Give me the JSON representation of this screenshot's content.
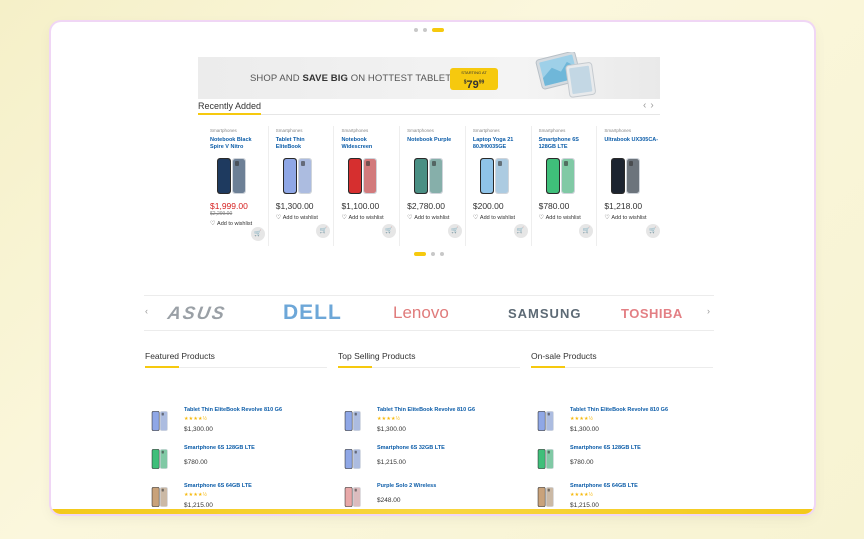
{
  "banner": {
    "text_pre": "SHOP AND ",
    "text_bold": "SAVE BIG",
    "text_post": " ON HOTTEST TABLETS",
    "price_small": "STARTING AT",
    "price_dollar": "$",
    "price_main": "79",
    "price_cents": "99"
  },
  "recent": {
    "title": "Recently Added",
    "prev": "‹",
    "next": "›",
    "products": [
      {
        "category": "Smartphones",
        "name": "Notebook Black Spire V Nitro",
        "price": "$1,999.00",
        "old_price": "$2,299.00",
        "sale": true,
        "wishlist": "Add to wishlist",
        "phone_color": "#1e3a5f"
      },
      {
        "category": "Smartphones",
        "name": "Tablet Thin EliteBook",
        "price": "$1,300.00",
        "old_price": "",
        "sale": false,
        "wishlist": "Add to wishlist",
        "phone_color": "#8fa7e6"
      },
      {
        "category": "Smartphones",
        "name": "Notebook Widescreen",
        "price": "$1,100.00",
        "old_price": "",
        "sale": false,
        "wishlist": "Add to wishlist",
        "phone_color": "#d62f2f"
      },
      {
        "category": "Smartphones",
        "name": "Notebook Purple",
        "price": "$2,780.00",
        "old_price": "",
        "sale": false,
        "wishlist": "Add to wishlist",
        "phone_color": "#4a8f84"
      },
      {
        "category": "Smartphones",
        "name": "Laptop Yoga 21 80JH0035GE",
        "price": "$200.00",
        "old_price": "",
        "sale": false,
        "wishlist": "Add to wishlist",
        "phone_color": "#8fc3e8"
      },
      {
        "category": "Smartphones",
        "name": "Smartphone 6S 128GB LTE",
        "price": "$780.00",
        "old_price": "",
        "sale": false,
        "wishlist": "Add to wishlist",
        "phone_color": "#3fbf7a"
      },
      {
        "category": "Smartphones",
        "name": "Ultrabook UX305CA-",
        "price": "$1,218.00",
        "old_price": "",
        "sale": false,
        "wishlist": "Add to wishlist",
        "phone_color": "#1c2430"
      }
    ]
  },
  "brands": {
    "prev": "‹",
    "next": "›",
    "items": [
      "ASUS",
      "DELL",
      "Lenovo",
      "SAMSUNG",
      "TOSHIBA"
    ]
  },
  "featured": {
    "title": "Featured Products",
    "items": [
      {
        "name": "Tablet Thin EliteBook Revolve 810 G6",
        "stars": "★★★★½",
        "price": "$1,300.00",
        "color": "#8fa7e6"
      },
      {
        "name": "Smartphone 6S 128GB LTE",
        "stars": "",
        "price": "$780.00",
        "color": "#3fbf7a"
      },
      {
        "name": "Smartphone 6S 64GB LTE",
        "stars": "★★★★½",
        "price": "$1,215.00",
        "color": "#c9a27a"
      }
    ]
  },
  "topselling": {
    "title": "Top Selling Products",
    "items": [
      {
        "name": "Tablet Thin EliteBook Revolve 810 G6",
        "stars": "★★★★½",
        "price": "$1,300.00",
        "color": "#8fa7e6"
      },
      {
        "name": "Smartphone 6S 32GB LTE",
        "stars": "",
        "price": "$1,215.00",
        "color": "#8fa7e6"
      },
      {
        "name": "Purple Solo 2 Wireless",
        "stars": "",
        "price": "$248.00",
        "color": "#e8a8a8"
      }
    ]
  },
  "onsale": {
    "title": "On-sale Products",
    "items": [
      {
        "name": "Tablet Thin EliteBook Revolve 810 G6",
        "stars": "★★★★½",
        "price": "$1,300.00",
        "color": "#8fa7e6"
      },
      {
        "name": "Smartphone 6S 128GB LTE",
        "stars": "",
        "price": "$780.00",
        "color": "#3fbf7a"
      },
      {
        "name": "Smartphone 6S 64GB LTE",
        "stars": "★★★★½",
        "price": "$1,215.00",
        "color": "#c9a27a"
      }
    ]
  },
  "colors": {
    "accent": "#f6c90e",
    "link": "#0b5ca8",
    "sale": "#d62020"
  }
}
